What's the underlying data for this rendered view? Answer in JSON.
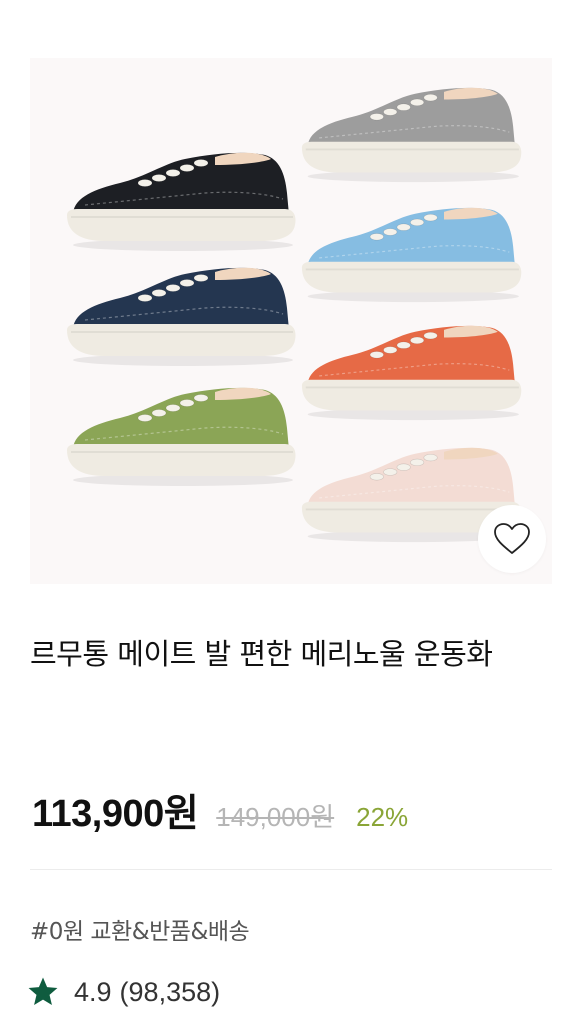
{
  "product": {
    "image_alt": "6 colors of knit sneakers",
    "shoe_colors": [
      "#1d1f24",
      "#243650",
      "#8ba556",
      "#9d9d9d",
      "#86bde2",
      "#e66a46",
      "#f3dcd4"
    ],
    "sole_color": "#efebe2",
    "accent_green": "#8aa537",
    "star_color": "#0f5c3f",
    "title": "르무통 메이트 발 편한 메리노울 운동화",
    "sale_price": "113,900원",
    "original_price": "149,000원",
    "discount_rate": "22%",
    "shipping_info": "#0원 교환&반품&배송",
    "rating": "4.9",
    "review_count": "(98,358)"
  }
}
